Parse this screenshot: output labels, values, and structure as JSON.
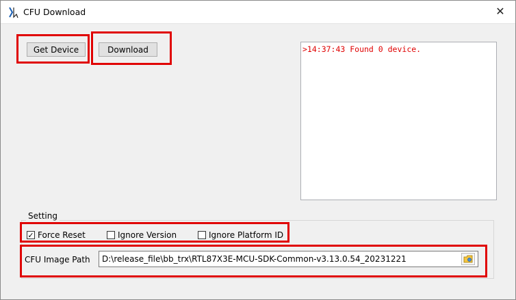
{
  "window": {
    "title": "CFU Download",
    "close_glyph": "✕"
  },
  "buttons": {
    "get_device": "Get Device",
    "download": "Download"
  },
  "log": {
    "lines": [
      ">14:37:43  Found 0 device."
    ],
    "text_color": "#e00000"
  },
  "setting": {
    "label": "Setting",
    "force_reset": {
      "label": "Force Reset",
      "checked": true
    },
    "ignore_version": {
      "label": "Ignore Version",
      "checked": false
    },
    "ignore_platform_id": {
      "label": "Ignore Platform ID",
      "checked": false
    }
  },
  "image_path": {
    "label": "CFU Image Path",
    "value": "D:\\release_file\\bb_trx\\RTL87X3E-MCU-SDK-Common-v3.13.0.54_20231221"
  },
  "icons": {
    "app": "cfu-app-icon",
    "browse": "folder-browse-icon",
    "close": "close-icon"
  },
  "colors": {
    "highlight": "#e00000"
  }
}
